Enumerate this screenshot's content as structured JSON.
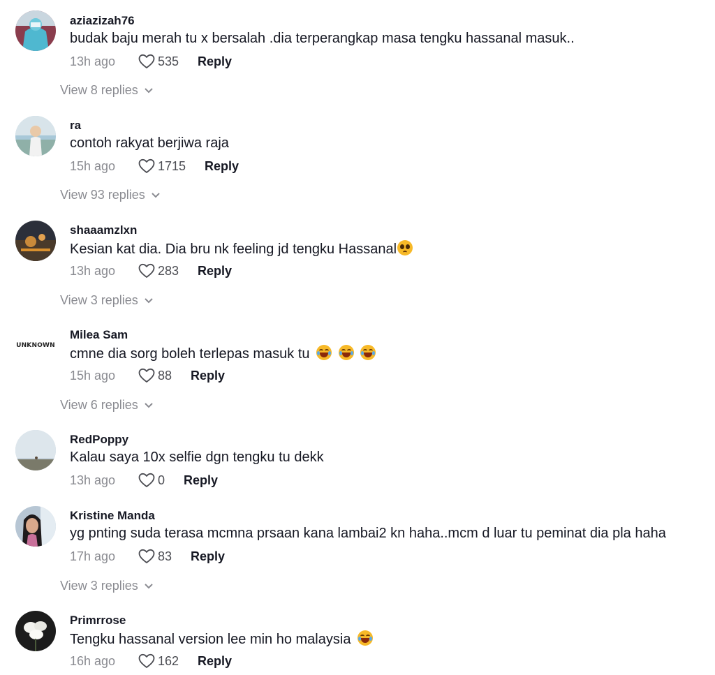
{
  "comments": [
    {
      "username": "aziazizah76",
      "text": "budak baju merah tu x bersalah .dia terperangkap masa tengku hassanal masuk..",
      "time": "13h ago",
      "likes": "535",
      "reply_label": "Reply",
      "view_replies": "View 8 replies"
    },
    {
      "username": "ra",
      "text": "contoh rakyat berjiwa raja",
      "time": "15h ago",
      "likes": "1715",
      "reply_label": "Reply",
      "view_replies": "View 93 replies"
    },
    {
      "username": "shaaamzlxn",
      "text": "Kesian kat dia. Dia bru nk feeling jd tengku Hassanal",
      "emoji": "pleading-face-emoji",
      "time": "13h ago",
      "likes": "283",
      "reply_label": "Reply",
      "view_replies": "View 3 replies"
    },
    {
      "username": "Milea Sam",
      "avatar_text": "UNKNOWN",
      "text": "cmne dia sorg boleh terlepas masuk tu",
      "emoji": "laughing-crying-emoji x3",
      "time": "15h ago",
      "likes": "88",
      "reply_label": "Reply",
      "view_replies": "View 6 replies"
    },
    {
      "username": "RedPoppy",
      "text": "Kalau saya 10x selfie dgn tengku tu dekk",
      "time": "13h ago",
      "likes": "0",
      "reply_label": "Reply"
    },
    {
      "username": "Kristine Manda",
      "text": "yg pnting suda terasa mcmna prsaan kana lambai2 kn haha..mcm d luar tu peminat dia pla haha",
      "time": "17h ago",
      "likes": "83",
      "reply_label": "Reply",
      "view_replies": "View 3 replies"
    },
    {
      "username": "Primrrose",
      "text": "Tengku hassanal version lee min ho malaysia",
      "emoji": "laughing-crying-emoji",
      "time": "16h ago",
      "likes": "162",
      "reply_label": "Reply"
    }
  ],
  "icons": {
    "like": "heart-outline-icon",
    "expand": "chevron-down-icon"
  },
  "colors": {
    "text": "#161823",
    "muted": "#8a8b91",
    "emoji": "#f7b928"
  }
}
